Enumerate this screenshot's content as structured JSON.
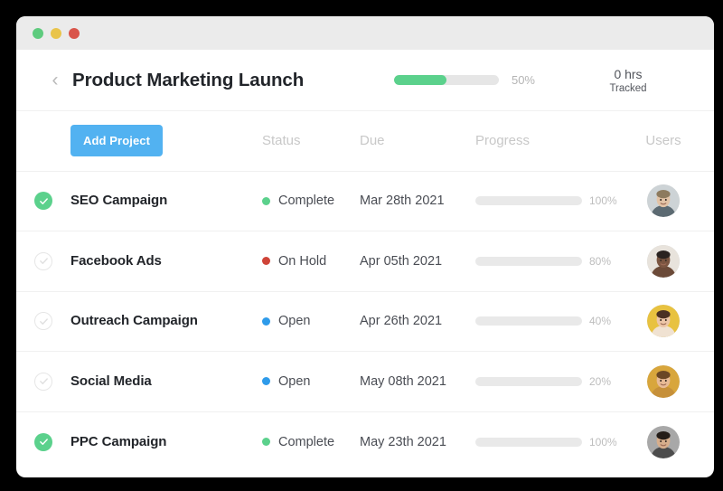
{
  "window": {
    "traffic_lights": [
      {
        "name": "minimize-dot",
        "color": "#5ecb7e"
      },
      {
        "name": "maximize-dot",
        "color": "#e9c44b"
      },
      {
        "name": "close-dot",
        "color": "#d9544a"
      }
    ]
  },
  "header": {
    "back_icon": "‹",
    "title": "Product Marketing Launch",
    "progress_percent": 50,
    "progress_label": "50%",
    "progress_color": "#5bd18c",
    "tracked_value": "0 hrs",
    "tracked_label": "Tracked"
  },
  "toolbar": {
    "add_project_label": "Add Project",
    "add_project_color": "#52b2f1"
  },
  "table": {
    "columns": {
      "status": "Status",
      "due": "Due",
      "progress": "Progress",
      "users": "Users"
    },
    "rows": [
      {
        "name": "SEO Campaign",
        "checked": true,
        "status": "Complete",
        "status_color": "#5bd18c",
        "due": "Mar 28th 2021",
        "progress": 100,
        "progress_label": "100%",
        "progress_color": "#5bd18c",
        "avatar_name": "avatar-seo-campaign",
        "avatar_bg": "#cdd3d6",
        "avatar_skin": "#e3c3a6",
        "avatar_hair": "#8d7a5e",
        "avatar_shirt": "#5c6a72"
      },
      {
        "name": "Facebook Ads",
        "checked": false,
        "status": "On Hold",
        "status_color": "#cf4438",
        "due": "Apr 05th 2021",
        "progress": 80,
        "progress_label": "80%",
        "progress_color": "#cf4438",
        "avatar_name": "avatar-facebook-ads",
        "avatar_bg": "#e8e3dc",
        "avatar_skin": "#7b5540",
        "avatar_hair": "#2b2320",
        "avatar_shirt": "#6b4a38"
      },
      {
        "name": "Outreach Campaign",
        "checked": false,
        "status": "Open",
        "status_color": "#2e9bea",
        "due": "Apr 26th 2021",
        "progress": 40,
        "progress_label": "40%",
        "progress_color": "#2e9bea",
        "avatar_name": "avatar-outreach-campaign",
        "avatar_bg": "#e8c240",
        "avatar_skin": "#edc6a8",
        "avatar_hair": "#4a3124",
        "avatar_shirt": "#f0e2d2"
      },
      {
        "name": "Social Media",
        "checked": false,
        "status": "Open",
        "status_color": "#2e9bea",
        "due": "May 08th 2021",
        "progress": 20,
        "progress_label": "20%",
        "progress_color": "#2e9bea",
        "avatar_name": "avatar-social-media",
        "avatar_bg": "#d8a63c",
        "avatar_skin": "#e8bb96",
        "avatar_hair": "#6a4726",
        "avatar_shirt": "#c6903a"
      },
      {
        "name": "PPC Campaign",
        "checked": true,
        "status": "Complete",
        "status_color": "#5bd18c",
        "due": "May 23th 2021",
        "progress": 100,
        "progress_label": "100%",
        "progress_color": "#5bd18c",
        "avatar_name": "avatar-ppc-campaign",
        "avatar_bg": "#a8a8a8",
        "avatar_skin": "#d7ae8c",
        "avatar_hair": "#241d18",
        "avatar_shirt": "#4c4c4c"
      }
    ]
  }
}
